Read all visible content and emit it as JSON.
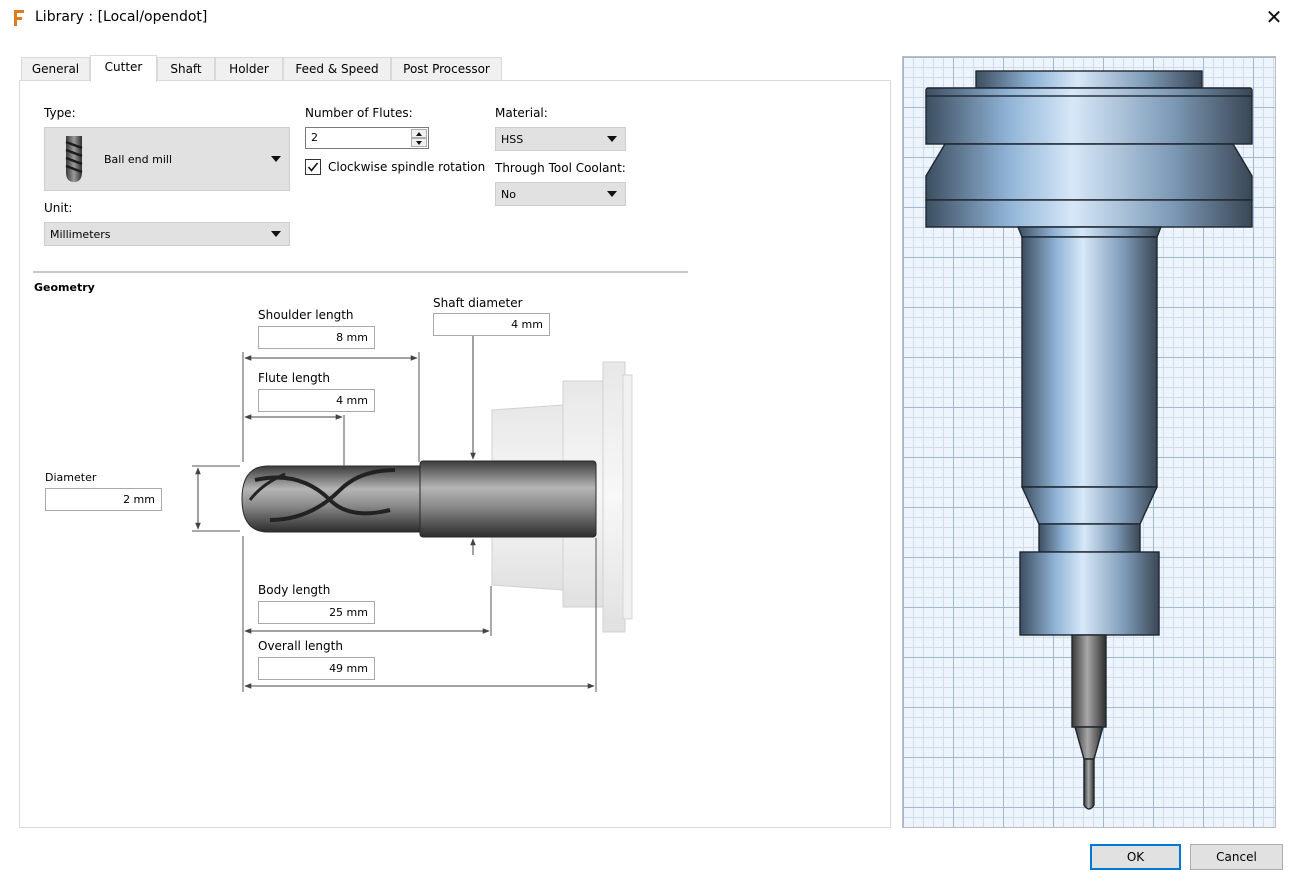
{
  "window": {
    "title": "Library :  [Local/opendot]",
    "close_glyph": "✕"
  },
  "tabs": [
    {
      "label": "General",
      "active": false
    },
    {
      "label": "Cutter",
      "active": true
    },
    {
      "label": "Shaft",
      "active": false
    },
    {
      "label": "Holder",
      "active": false
    },
    {
      "label": "Feed & Speed",
      "active": false
    },
    {
      "label": "Post Processor",
      "active": false
    }
  ],
  "cutter": {
    "type_label": "Type:",
    "type_value": "Ball end mill",
    "unit_label": "Unit:",
    "unit_value": "Millimeters",
    "flutes_label": "Number of Flutes:",
    "flutes_value": "2",
    "clockwise_label": "Clockwise spindle rotation",
    "clockwise_checked": true,
    "material_label": "Material:",
    "material_value": "HSS",
    "coolant_label": "Through Tool Coolant:",
    "coolant_value": "No"
  },
  "geometry": {
    "heading": "Geometry",
    "shoulder_length_label": "Shoulder length",
    "shoulder_length_value": "8 mm",
    "flute_length_label": "Flute length",
    "flute_length_value": "4 mm",
    "shaft_diameter_label": "Shaft diameter",
    "shaft_diameter_value": "4 mm",
    "diameter_label": "Diameter",
    "diameter_value": "2 mm",
    "body_length_label": "Body length",
    "body_length_value": "25 mm",
    "overall_length_label": "Overall length",
    "overall_length_value": "49 mm"
  },
  "buttons": {
    "ok": "OK",
    "cancel": "Cancel"
  },
  "colors": {
    "accent": "#0078d7",
    "grid": "#9fb9d6",
    "tool_blue": "#8fb3d6"
  }
}
